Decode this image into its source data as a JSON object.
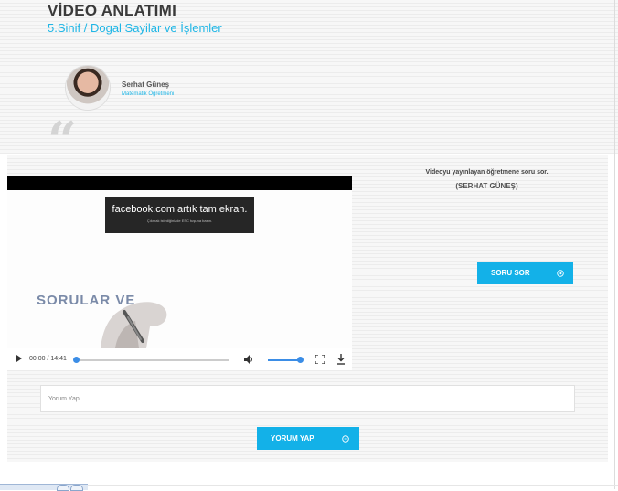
{
  "header": {
    "title": "VİDEO ANLATIMI",
    "subtitle": "5.Sinif / Dogal Sayilar ve İşlemler"
  },
  "teacher": {
    "name": "Serhat Güneş",
    "role": "Matematik Öğretmeni",
    "avatar_icon": "teacher-avatar"
  },
  "quote_mark": "“",
  "video": {
    "fullscreen_notice": "facebook.com artık tam ekran.",
    "fullscreen_hint": "Çıkmak istediğinizde ESC tuşuna basın.",
    "caption": "SORULAR VE",
    "time": "00:00 / 14:41",
    "progress": 0,
    "volume": 1.0,
    "icons": [
      "play-icon",
      "volume-icon",
      "fullscreen-icon",
      "download-icon"
    ]
  },
  "ask": {
    "prompt": "Videoyu yayınlayan öğretmene soru sor.",
    "teacher": "(SERHAT GÜNEŞ)",
    "button_label": "SORU SOR",
    "button_icon": "arrow-right-circle-icon"
  },
  "comment": {
    "placeholder": "Yorum Yap",
    "value": "",
    "button_label": "YORUM YAP",
    "button_icon": "arrow-right-circle-icon"
  },
  "colors": {
    "accent": "#13b1e8",
    "subtitle": "#1fb6e6",
    "title": "#3a3a3a",
    "progress": "#3b8de6"
  }
}
